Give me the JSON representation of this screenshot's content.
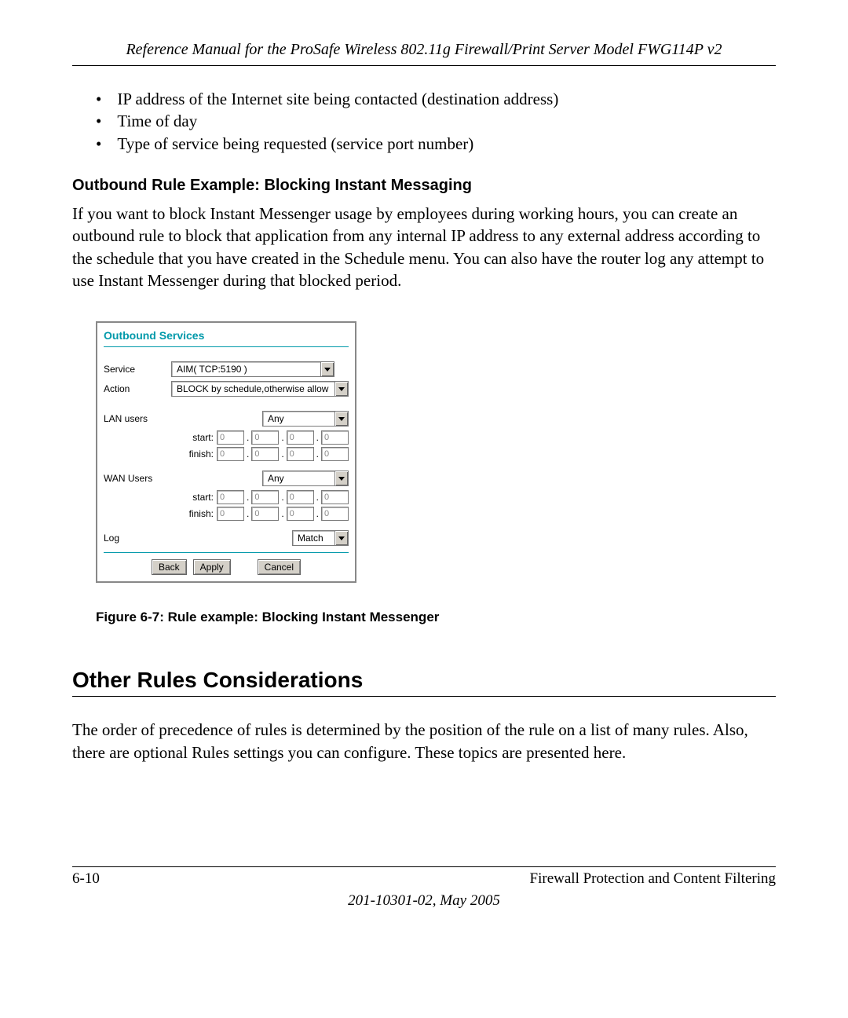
{
  "header": {
    "title": "Reference Manual for the ProSafe Wireless 802.11g  Firewall/Print Server Model FWG114P v2"
  },
  "bullets": [
    "IP address of the Internet site being contacted (destination address)",
    "Time of day",
    "Type of service being requested (service port number)"
  ],
  "subheading": "Outbound Rule Example: Blocking Instant Messaging",
  "paragraph1": "If you want to block Instant Messenger usage by employees during working hours, you can create an outbound rule to block that application from any internal IP address to any external address according to the schedule that you have created in the Schedule menu. You can also have the router log any attempt to use Instant Messenger during that blocked period.",
  "panel": {
    "title": "Outbound Services",
    "service_label": "Service",
    "service_value": "AIM( TCP:5190 )",
    "action_label": "Action",
    "action_value": "BLOCK by schedule,otherwise allow",
    "lan_label": "LAN users",
    "lan_value": "Any",
    "wan_label": "WAN Users",
    "wan_value": "Any",
    "start_label": "start:",
    "finish_label": "finish:",
    "oct": "0",
    "log_label": "Log",
    "log_value": "Match",
    "btn_back": "Back",
    "btn_apply": "Apply",
    "btn_cancel": "Cancel"
  },
  "figcaption": "Figure 6-7:  Rule example: Blocking Instant Messenger",
  "heading2": "Other Rules Considerations",
  "paragraph2": "The order of precedence of rules is determined by the position of the rule on a list of many rules. Also, there are optional Rules settings you can configure. These topics are presented here.",
  "footer": {
    "pagenum": "6-10",
    "section": "Firewall Protection and Content Filtering",
    "date": "201-10301-02, May 2005"
  }
}
